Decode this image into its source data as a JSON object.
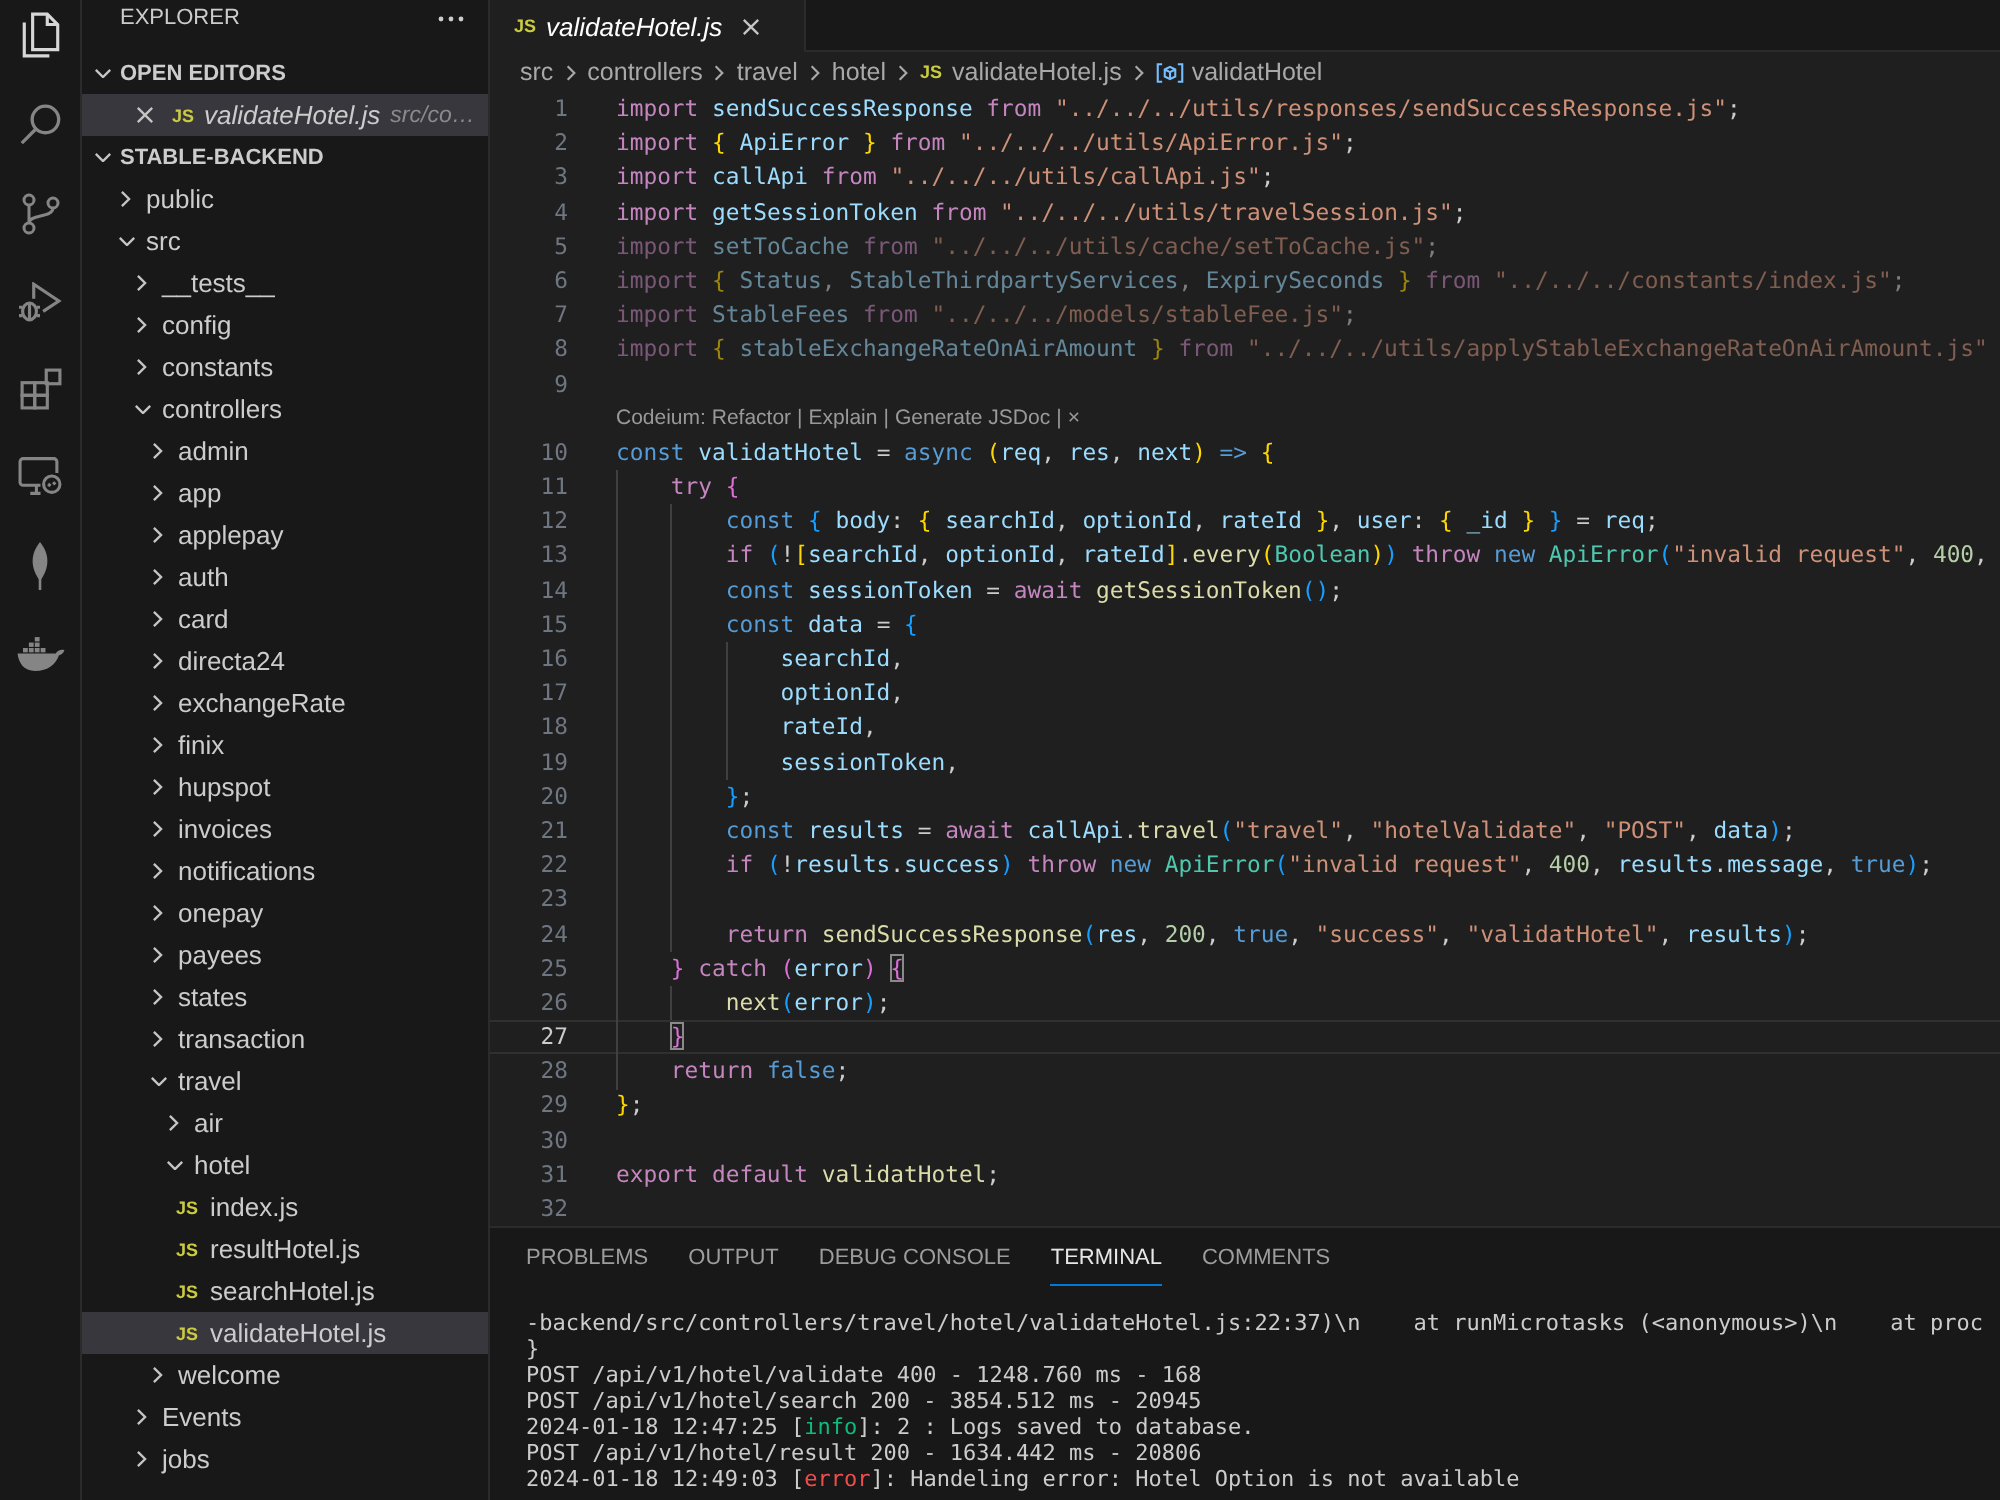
{
  "activity_bar": [
    {
      "kind": "files",
      "selected": true
    },
    {
      "kind": "search",
      "selected": false
    },
    {
      "kind": "branch",
      "selected": false
    },
    {
      "kind": "debug",
      "selected": false
    },
    {
      "kind": "extensions",
      "selected": false
    },
    {
      "kind": "remote",
      "selected": false
    },
    {
      "kind": "leaf",
      "selected": false
    },
    {
      "kind": "whale",
      "selected": false
    }
  ],
  "sidebar": {
    "title": "EXPLORER",
    "open_editors": {
      "title": "OPEN EDITORS",
      "expanded": true,
      "items": [
        {
          "badge": "JS",
          "name": "validateHotel.js",
          "path": "src/co…",
          "selected": true
        }
      ]
    },
    "project": {
      "title": "STABLE-BACKEND",
      "expanded": true,
      "tree": [
        {
          "label": "public",
          "kind": "folder",
          "expanded": false,
          "selected": false
        },
        {
          "label": "src",
          "kind": "folder",
          "expanded": true,
          "selected": false,
          "children": [
            {
              "label": "__tests__",
              "kind": "folder",
              "expanded": false,
              "selected": false
            },
            {
              "label": "config",
              "kind": "folder",
              "expanded": false,
              "selected": false
            },
            {
              "label": "constants",
              "kind": "folder",
              "expanded": false,
              "selected": false
            },
            {
              "label": "controllers",
              "kind": "folder",
              "expanded": true,
              "selected": false,
              "children": [
                {
                  "label": "admin",
                  "kind": "folder",
                  "expanded": false,
                  "selected": false
                },
                {
                  "label": "app",
                  "kind": "folder",
                  "expanded": false,
                  "selected": false
                },
                {
                  "label": "applepay",
                  "kind": "folder",
                  "expanded": false,
                  "selected": false
                },
                {
                  "label": "auth",
                  "kind": "folder",
                  "expanded": false,
                  "selected": false
                },
                {
                  "label": "card",
                  "kind": "folder",
                  "expanded": false,
                  "selected": false
                },
                {
                  "label": "directa24",
                  "kind": "folder",
                  "expanded": false,
                  "selected": false
                },
                {
                  "label": "exchangeRate",
                  "kind": "folder",
                  "expanded": false,
                  "selected": false
                },
                {
                  "label": "finix",
                  "kind": "folder",
                  "expanded": false,
                  "selected": false
                },
                {
                  "label": "hupspot",
                  "kind": "folder",
                  "expanded": false,
                  "selected": false
                },
                {
                  "label": "invoices",
                  "kind": "folder",
                  "expanded": false,
                  "selected": false
                },
                {
                  "label": "notifications",
                  "kind": "folder",
                  "expanded": false,
                  "selected": false
                },
                {
                  "label": "onepay",
                  "kind": "folder",
                  "expanded": false,
                  "selected": false
                },
                {
                  "label": "payees",
                  "kind": "folder",
                  "expanded": false,
                  "selected": false
                },
                {
                  "label": "states",
                  "kind": "folder",
                  "expanded": false,
                  "selected": false
                },
                {
                  "label": "transaction",
                  "kind": "folder",
                  "expanded": false,
                  "selected": false
                },
                {
                  "label": "travel",
                  "kind": "folder",
                  "expanded": true,
                  "selected": false,
                  "children": [
                    {
                      "label": "air",
                      "kind": "folder",
                      "expanded": false,
                      "selected": false
                    },
                    {
                      "label": "hotel",
                      "kind": "folder",
                      "expanded": true,
                      "selected": false,
                      "children": [
                        {
                          "label": "index.js",
                          "kind": "file",
                          "badge": "JS",
                          "selected": false
                        },
                        {
                          "label": "resultHotel.js",
                          "kind": "file",
                          "badge": "JS",
                          "selected": false
                        },
                        {
                          "label": "searchHotel.js",
                          "kind": "file",
                          "badge": "JS",
                          "selected": false
                        },
                        {
                          "label": "validateHotel.js",
                          "kind": "file",
                          "badge": "JS",
                          "selected": true
                        }
                      ]
                    }
                  ]
                },
                {
                  "label": "welcome",
                  "kind": "folder",
                  "expanded": false,
                  "selected": false
                }
              ]
            },
            {
              "label": "Events",
              "kind": "folder",
              "expanded": false,
              "selected": false
            },
            {
              "label": "jobs",
              "kind": "folder",
              "expanded": false,
              "selected": false
            }
          ]
        }
      ]
    }
  },
  "editor": {
    "tabs": [
      {
        "badge": "JS",
        "label": "validateHotel.js",
        "preview": true,
        "selected": true
      }
    ],
    "breadcrumb": [
      {
        "kind": "folder",
        "label": "src"
      },
      {
        "kind": "folder",
        "label": "controllers"
      },
      {
        "kind": "folder",
        "label": "travel"
      },
      {
        "kind": "folder",
        "label": "hotel"
      },
      {
        "kind": "file",
        "badge": "JS",
        "label": "validateHotel.js"
      },
      {
        "kind": "symbol",
        "label": "validatHotel"
      }
    ],
    "lines": [
      {
        "kind": "code",
        "number": "1",
        "current": false,
        "dimmed": false,
        "tokens": [
          {
            "kind": "kw",
            "text": "import "
          },
          {
            "kind": "var",
            "text": "sendSuccessResponse "
          },
          {
            "kind": "kw",
            "text": "from "
          },
          {
            "kind": "str",
            "text": "\"../../../utils/responses/sendSuccessResponse.js\""
          },
          {
            "kind": "p",
            "text": ";"
          }
        ]
      },
      {
        "kind": "code",
        "number": "2",
        "current": false,
        "dimmed": false,
        "tokens": [
          {
            "kind": "kw",
            "text": "import "
          },
          {
            "kind": "b1",
            "text": "{ "
          },
          {
            "kind": "var",
            "text": "ApiError "
          },
          {
            "kind": "b1",
            "text": "} "
          },
          {
            "kind": "kw",
            "text": "from "
          },
          {
            "kind": "str",
            "text": "\"../../../utils/ApiError.js\""
          },
          {
            "kind": "p",
            "text": ";"
          }
        ]
      },
      {
        "kind": "code",
        "number": "3",
        "current": false,
        "dimmed": false,
        "tokens": [
          {
            "kind": "kw",
            "text": "import "
          },
          {
            "kind": "var",
            "text": "callApi "
          },
          {
            "kind": "kw",
            "text": "from "
          },
          {
            "kind": "str",
            "text": "\"../../../utils/callApi.js\""
          },
          {
            "kind": "p",
            "text": ";"
          }
        ]
      },
      {
        "kind": "code",
        "number": "4",
        "current": false,
        "dimmed": false,
        "tokens": [
          {
            "kind": "kw",
            "text": "import "
          },
          {
            "kind": "var",
            "text": "getSessionToken "
          },
          {
            "kind": "kw",
            "text": "from "
          },
          {
            "kind": "str",
            "text": "\"../../../utils/travelSession.js\""
          },
          {
            "kind": "p",
            "text": ";"
          }
        ]
      },
      {
        "kind": "code",
        "number": "5",
        "current": false,
        "dimmed": true,
        "tokens": [
          {
            "kind": "kw",
            "text": "import "
          },
          {
            "kind": "var",
            "text": "setToCache "
          },
          {
            "kind": "kw",
            "text": "from "
          },
          {
            "kind": "str",
            "text": "\"../../../utils/cache/setToCache.js\""
          },
          {
            "kind": "p",
            "text": ";"
          }
        ]
      },
      {
        "kind": "code",
        "number": "6",
        "current": false,
        "dimmed": true,
        "tokens": [
          {
            "kind": "kw",
            "text": "import "
          },
          {
            "kind": "b1",
            "text": "{ "
          },
          {
            "kind": "var",
            "text": "Status"
          },
          {
            "kind": "p",
            "text": ", "
          },
          {
            "kind": "var",
            "text": "StableThirdpartyServices"
          },
          {
            "kind": "p",
            "text": ", "
          },
          {
            "kind": "var",
            "text": "ExpirySeconds "
          },
          {
            "kind": "b1",
            "text": "} "
          },
          {
            "kind": "kw",
            "text": "from "
          },
          {
            "kind": "str",
            "text": "\"../../../constants/index.js\""
          },
          {
            "kind": "p",
            "text": ";"
          }
        ]
      },
      {
        "kind": "code",
        "number": "7",
        "current": false,
        "dimmed": true,
        "tokens": [
          {
            "kind": "kw",
            "text": "import "
          },
          {
            "kind": "var",
            "text": "StableFees "
          },
          {
            "kind": "kw",
            "text": "from "
          },
          {
            "kind": "str",
            "text": "\"../../../models/stableFee.js\""
          },
          {
            "kind": "p",
            "text": ";"
          }
        ]
      },
      {
        "kind": "code",
        "number": "8",
        "current": false,
        "dimmed": true,
        "tokens": [
          {
            "kind": "kw",
            "text": "import "
          },
          {
            "kind": "b1",
            "text": "{ "
          },
          {
            "kind": "var",
            "text": "stableExchangeRateOnAirAmount "
          },
          {
            "kind": "b1",
            "text": "} "
          },
          {
            "kind": "kw",
            "text": "from "
          },
          {
            "kind": "str",
            "text": "\"../../../utils/applyStableExchangeRateOnAirAmount.js\""
          }
        ]
      },
      {
        "kind": "code",
        "number": "9",
        "current": false
      },
      {
        "kind": "lens",
        "separator": "|",
        "items": [
          "Codeium: Refactor",
          "Explain",
          "Generate JSDoc",
          "×"
        ]
      },
      {
        "kind": "code",
        "number": "10",
        "current": false,
        "dimmed": false,
        "tokens": [
          {
            "kind": "st",
            "text": "const "
          },
          {
            "kind": "var",
            "text": "validatHotel "
          },
          {
            "kind": "p",
            "text": "= "
          },
          {
            "kind": "st",
            "text": "async "
          },
          {
            "kind": "b1",
            "text": "("
          },
          {
            "kind": "var",
            "text": "req"
          },
          {
            "kind": "p",
            "text": ", "
          },
          {
            "kind": "var",
            "text": "res"
          },
          {
            "kind": "p",
            "text": ", "
          },
          {
            "kind": "var",
            "text": "next"
          },
          {
            "kind": "b1",
            "text": ") "
          },
          {
            "kind": "st",
            "text": "=> "
          },
          {
            "kind": "b1",
            "text": "{"
          }
        ],
        "children": [
          {
            "kind": "code",
            "number": "11",
            "current": false,
            "dimmed": false,
            "tokens": [
              {
                "kind": "kw",
                "text": "try "
              },
              {
                "kind": "b2",
                "text": "{"
              }
            ],
            "children": [
              {
                "kind": "code",
                "number": "12",
                "current": false,
                "dimmed": false,
                "tokens": [
                  {
                    "kind": "st",
                    "text": "const "
                  },
                  {
                    "kind": "b3",
                    "text": "{ "
                  },
                  {
                    "kind": "var",
                    "text": "body"
                  },
                  {
                    "kind": "p",
                    "text": ": "
                  },
                  {
                    "kind": "b1",
                    "text": "{ "
                  },
                  {
                    "kind": "var",
                    "text": "searchId"
                  },
                  {
                    "kind": "p",
                    "text": ", "
                  },
                  {
                    "kind": "var",
                    "text": "optionId"
                  },
                  {
                    "kind": "p",
                    "text": ", "
                  },
                  {
                    "kind": "var",
                    "text": "rateId "
                  },
                  {
                    "kind": "b1",
                    "text": "}"
                  },
                  {
                    "kind": "p",
                    "text": ", "
                  },
                  {
                    "kind": "var",
                    "text": "user"
                  },
                  {
                    "kind": "p",
                    "text": ": "
                  },
                  {
                    "kind": "b1",
                    "text": "{ "
                  },
                  {
                    "kind": "var",
                    "text": "_id "
                  },
                  {
                    "kind": "b1",
                    "text": "} "
                  },
                  {
                    "kind": "b3",
                    "text": "} "
                  },
                  {
                    "kind": "p",
                    "text": "= "
                  },
                  {
                    "kind": "var",
                    "text": "req"
                  },
                  {
                    "kind": "p",
                    "text": ";"
                  }
                ]
              },
              {
                "kind": "code",
                "number": "13",
                "current": false,
                "dimmed": false,
                "tokens": [
                  {
                    "kind": "kw",
                    "text": "if "
                  },
                  {
                    "kind": "b3",
                    "text": "("
                  },
                  {
                    "kind": "p",
                    "text": "!"
                  },
                  {
                    "kind": "b1",
                    "text": "["
                  },
                  {
                    "kind": "var",
                    "text": "searchId"
                  },
                  {
                    "kind": "p",
                    "text": ", "
                  },
                  {
                    "kind": "var",
                    "text": "optionId"
                  },
                  {
                    "kind": "p",
                    "text": ", "
                  },
                  {
                    "kind": "var",
                    "text": "rateId"
                  },
                  {
                    "kind": "b1",
                    "text": "]"
                  },
                  {
                    "kind": "p",
                    "text": "."
                  },
                  {
                    "kind": "fn",
                    "text": "every"
                  },
                  {
                    "kind": "b1",
                    "text": "("
                  },
                  {
                    "kind": "cls",
                    "text": "Boolean"
                  },
                  {
                    "kind": "b1",
                    "text": ")"
                  },
                  {
                    "kind": "b3",
                    "text": ") "
                  },
                  {
                    "kind": "kw",
                    "text": "throw "
                  },
                  {
                    "kind": "st",
                    "text": "new "
                  },
                  {
                    "kind": "cls",
                    "text": "ApiError"
                  },
                  {
                    "kind": "b3",
                    "text": "("
                  },
                  {
                    "kind": "str",
                    "text": "\"invalid request\""
                  },
                  {
                    "kind": "p",
                    "text": ", "
                  },
                  {
                    "kind": "num",
                    "text": "400"
                  },
                  {
                    "kind": "p",
                    "text": ","
                  }
                ]
              },
              {
                "kind": "code",
                "number": "14",
                "current": false,
                "dimmed": false,
                "tokens": [
                  {
                    "kind": "st",
                    "text": "const "
                  },
                  {
                    "kind": "var",
                    "text": "sessionToken "
                  },
                  {
                    "kind": "p",
                    "text": "= "
                  },
                  {
                    "kind": "kw",
                    "text": "await "
                  },
                  {
                    "kind": "fn",
                    "text": "getSessionToken"
                  },
                  {
                    "kind": "b3",
                    "text": "()"
                  },
                  {
                    "kind": "p",
                    "text": ";"
                  }
                ]
              },
              {
                "kind": "code",
                "number": "15",
                "current": false,
                "dimmed": false,
                "tokens": [
                  {
                    "kind": "st",
                    "text": "const "
                  },
                  {
                    "kind": "var",
                    "text": "data "
                  },
                  {
                    "kind": "p",
                    "text": "= "
                  },
                  {
                    "kind": "b3",
                    "text": "{"
                  }
                ],
                "children": [
                  {
                    "kind": "code",
                    "number": "16",
                    "current": false,
                    "dimmed": false,
                    "tokens": [
                      {
                        "kind": "var",
                        "text": "searchId"
                      },
                      {
                        "kind": "p",
                        "text": ","
                      }
                    ]
                  },
                  {
                    "kind": "code",
                    "number": "17",
                    "current": false,
                    "dimmed": false,
                    "tokens": [
                      {
                        "kind": "var",
                        "text": "optionId"
                      },
                      {
                        "kind": "p",
                        "text": ","
                      }
                    ]
                  },
                  {
                    "kind": "code",
                    "number": "18",
                    "current": false,
                    "dimmed": false,
                    "tokens": [
                      {
                        "kind": "var",
                        "text": "rateId"
                      },
                      {
                        "kind": "p",
                        "text": ","
                      }
                    ]
                  },
                  {
                    "kind": "code",
                    "number": "19",
                    "current": false,
                    "dimmed": false,
                    "tokens": [
                      {
                        "kind": "var",
                        "text": "sessionToken"
                      },
                      {
                        "kind": "p",
                        "text": ","
                      }
                    ]
                  }
                ]
              },
              {
                "kind": "code",
                "number": "20",
                "current": false,
                "dimmed": false,
                "tokens": [
                  {
                    "kind": "b3",
                    "text": "}"
                  },
                  {
                    "kind": "p",
                    "text": ";"
                  }
                ]
              },
              {
                "kind": "code",
                "number": "21",
                "current": false,
                "dimmed": false,
                "tokens": [
                  {
                    "kind": "st",
                    "text": "const "
                  },
                  {
                    "kind": "var",
                    "text": "results "
                  },
                  {
                    "kind": "p",
                    "text": "= "
                  },
                  {
                    "kind": "kw",
                    "text": "await "
                  },
                  {
                    "kind": "var",
                    "text": "callApi"
                  },
                  {
                    "kind": "p",
                    "text": "."
                  },
                  {
                    "kind": "fn",
                    "text": "travel"
                  },
                  {
                    "kind": "b3",
                    "text": "("
                  },
                  {
                    "kind": "str",
                    "text": "\"travel\""
                  },
                  {
                    "kind": "p",
                    "text": ", "
                  },
                  {
                    "kind": "str",
                    "text": "\"hotelValidate\""
                  },
                  {
                    "kind": "p",
                    "text": ", "
                  },
                  {
                    "kind": "str",
                    "text": "\"POST\""
                  },
                  {
                    "kind": "p",
                    "text": ", "
                  },
                  {
                    "kind": "var",
                    "text": "data"
                  },
                  {
                    "kind": "b3",
                    "text": ")"
                  },
                  {
                    "kind": "p",
                    "text": ";"
                  }
                ]
              },
              {
                "kind": "code",
                "number": "22",
                "current": false,
                "dimmed": false,
                "tokens": [
                  {
                    "kind": "kw",
                    "text": "if "
                  },
                  {
                    "kind": "b3",
                    "text": "("
                  },
                  {
                    "kind": "p",
                    "text": "!"
                  },
                  {
                    "kind": "var",
                    "text": "results"
                  },
                  {
                    "kind": "p",
                    "text": "."
                  },
                  {
                    "kind": "var",
                    "text": "success"
                  },
                  {
                    "kind": "b3",
                    "text": ") "
                  },
                  {
                    "kind": "kw",
                    "text": "throw "
                  },
                  {
                    "kind": "st",
                    "text": "new "
                  },
                  {
                    "kind": "cls",
                    "text": "ApiError"
                  },
                  {
                    "kind": "b3",
                    "text": "("
                  },
                  {
                    "kind": "str",
                    "text": "\"invalid request\""
                  },
                  {
                    "kind": "p",
                    "text": ", "
                  },
                  {
                    "kind": "num",
                    "text": "400"
                  },
                  {
                    "kind": "p",
                    "text": ", "
                  },
                  {
                    "kind": "var",
                    "text": "results"
                  },
                  {
                    "kind": "p",
                    "text": "."
                  },
                  {
                    "kind": "var",
                    "text": "message"
                  },
                  {
                    "kind": "p",
                    "text": ", "
                  },
                  {
                    "kind": "st",
                    "text": "true"
                  },
                  {
                    "kind": "b3",
                    "text": ")"
                  },
                  {
                    "kind": "p",
                    "text": ";"
                  }
                ]
              },
              {
                "kind": "code",
                "number": "23",
                "current": false
              },
              {
                "kind": "code",
                "number": "24",
                "current": false,
                "dimmed": false,
                "tokens": [
                  {
                    "kind": "kw",
                    "text": "return "
                  },
                  {
                    "kind": "fn",
                    "text": "sendSuccessResponse"
                  },
                  {
                    "kind": "b3",
                    "text": "("
                  },
                  {
                    "kind": "var",
                    "text": "res"
                  },
                  {
                    "kind": "p",
                    "text": ", "
                  },
                  {
                    "kind": "num",
                    "text": "200"
                  },
                  {
                    "kind": "p",
                    "text": ", "
                  },
                  {
                    "kind": "st",
                    "text": "true"
                  },
                  {
                    "kind": "p",
                    "text": ", "
                  },
                  {
                    "kind": "str",
                    "text": "\"success\""
                  },
                  {
                    "kind": "p",
                    "text": ", "
                  },
                  {
                    "kind": "str",
                    "text": "\"validatHotel\""
                  },
                  {
                    "kind": "p",
                    "text": ", "
                  },
                  {
                    "kind": "var",
                    "text": "results"
                  },
                  {
                    "kind": "b3",
                    "text": ")"
                  },
                  {
                    "kind": "p",
                    "text": ";"
                  }
                ]
              }
            ]
          },
          {
            "kind": "code",
            "number": "25",
            "current": false,
            "dimmed": false,
            "tokens": [
              {
                "kind": "b2",
                "text": "} "
              },
              {
                "kind": "kw",
                "text": "catch "
              },
              {
                "kind": "b2",
                "text": "("
              },
              {
                "kind": "var",
                "text": "error"
              },
              {
                "kind": "b2",
                "text": ") "
              },
              {
                "kind": "match",
                "text": "{"
              }
            ],
            "children": [
              {
                "kind": "code",
                "number": "26",
                "current": false,
                "dimmed": false,
                "tokens": [
                  {
                    "kind": "fn",
                    "text": "next"
                  },
                  {
                    "kind": "b3",
                    "text": "("
                  },
                  {
                    "kind": "var",
                    "text": "error"
                  },
                  {
                    "kind": "b3",
                    "text": ")"
                  },
                  {
                    "kind": "p",
                    "text": ";"
                  }
                ]
              }
            ]
          },
          {
            "kind": "code",
            "number": "27",
            "current": true,
            "dimmed": false,
            "tokens": [
              {
                "kind": "match",
                "text": "}"
              }
            ]
          },
          {
            "kind": "code",
            "number": "28",
            "current": false,
            "dimmed": false,
            "tokens": [
              {
                "kind": "kw",
                "text": "return "
              },
              {
                "kind": "st",
                "text": "false"
              },
              {
                "kind": "p",
                "text": ";"
              }
            ]
          }
        ]
      },
      {
        "kind": "code",
        "number": "29",
        "current": false,
        "dimmed": false,
        "tokens": [
          {
            "kind": "b1",
            "text": "}"
          },
          {
            "kind": "p",
            "text": ";"
          }
        ]
      },
      {
        "kind": "code",
        "number": "30",
        "current": false
      },
      {
        "kind": "code",
        "number": "31",
        "current": false,
        "dimmed": false,
        "tokens": [
          {
            "kind": "kw",
            "text": "export default "
          },
          {
            "kind": "fn",
            "text": "validatHotel"
          },
          {
            "kind": "p",
            "text": ";"
          }
        ]
      },
      {
        "kind": "code",
        "number": "32",
        "current": false
      }
    ]
  },
  "panel": {
    "tabs": [
      {
        "label": "PROBLEMS",
        "selected": false
      },
      {
        "label": "OUTPUT",
        "selected": false
      },
      {
        "label": "DEBUG CONSOLE",
        "selected": false
      },
      {
        "label": "TERMINAL",
        "selected": true
      },
      {
        "label": "COMMENTS",
        "selected": false
      }
    ],
    "terminal": [
      {
        "segments": [
          {
            "kind": "plain",
            "text": "-backend/src/controllers/travel/hotel/validateHotel.js:22:37)\\n    at runMicrotasks (<anonymous>)\\n    at proc"
          }
        ]
      },
      {
        "segments": [
          {
            "kind": "plain",
            "text": "}"
          }
        ]
      },
      {
        "segments": [
          {
            "kind": "plain",
            "text": "POST /api/v1/hotel/validate 400 - 1248.760 ms - 168"
          }
        ]
      },
      {
        "segments": [
          {
            "kind": "plain",
            "text": "POST /api/v1/hotel/search 200 - 3854.512 ms - 20945"
          }
        ]
      },
      {
        "segments": [
          {
            "kind": "plain",
            "text": "2024-01-18 12:47:25 ["
          },
          {
            "kind": "info",
            "text": "info"
          },
          {
            "kind": "plain",
            "text": "]: 2 : Logs saved to database."
          }
        ]
      },
      {
        "segments": [
          {
            "kind": "plain",
            "text": "POST /api/v1/hotel/result 200 - 1634.442 ms - 20806"
          }
        ]
      },
      {
        "segments": [
          {
            "kind": "plain",
            "text": "2024-01-18 12:49:03 ["
          },
          {
            "kind": "error",
            "text": "error"
          },
          {
            "kind": "plain",
            "text": "]: Handeling error: Hotel Option is not available"
          }
        ]
      }
    ]
  }
}
